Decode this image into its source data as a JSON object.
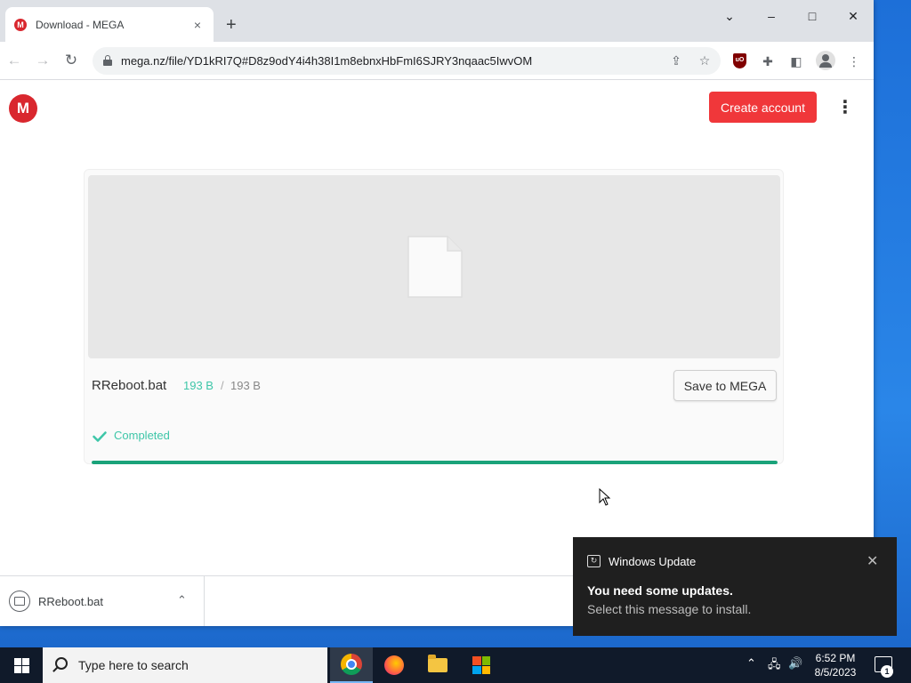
{
  "browser": {
    "tab_title": "Download - MEGA",
    "tab_favicon": "M",
    "tab_close": "×",
    "new_tab": "+",
    "url": "mega.nz/file/YD1kRI7Q#D8z9odY4i4h38I1m8ebnxHbFmI6SJRY3nqaac5IwvOM",
    "minimize": "–",
    "maximize": "□",
    "close": "✕",
    "tab_search": "⌄"
  },
  "page": {
    "logo": "M",
    "create_account_label": "Create account",
    "menu_glyph": "⋮",
    "file": {
      "name": "RReboot.bat",
      "downloaded": "193 B",
      "separator": "/",
      "total": "193 B",
      "progress": 1.0
    },
    "save_label": "Save to MEGA",
    "status": "Completed"
  },
  "download_shelf": {
    "file_name": "RReboot.bat",
    "chevron": "⌃"
  },
  "notification": {
    "app": "Windows Update",
    "title": "You need some updates.",
    "body": "Select this message to install.",
    "close": "✕"
  },
  "taskbar": {
    "search_placeholder": "Type here to search",
    "time": "6:52 PM",
    "date": "8/5/2023",
    "notification_count": "1",
    "tray_chevron": "⌃"
  },
  "colors": {
    "mega_red": "#d9272e",
    "create_button": "#f0373a",
    "success_green": "#3ec6a8",
    "progress_green": "#1aa37a"
  }
}
